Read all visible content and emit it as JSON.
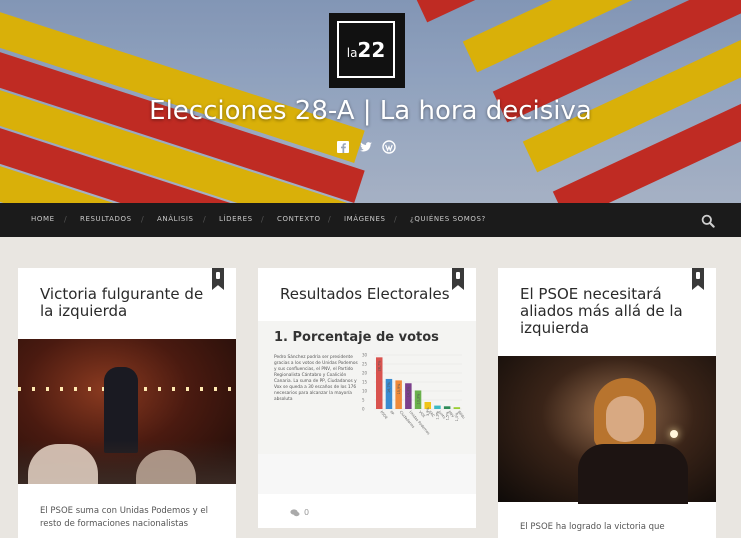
{
  "site": {
    "logo_prefix": "la",
    "logo_number": "22",
    "title": "Elecciones 28-A | La hora decisiva",
    "social_icons": [
      "facebook-icon",
      "twitter-icon",
      "wordpress-icon"
    ]
  },
  "nav": {
    "items": [
      "HOME",
      "RESULTADOS",
      "ANÁLISIS",
      "LÍDERES",
      "CONTEXTO",
      "IMÁGENES",
      "¿QUIÉNES SOMOS?"
    ],
    "separator": "/",
    "search_icon": "search-icon"
  },
  "colors": {
    "nav_bg": "#1b1b1b",
    "page_bg": "#e9e6e1",
    "flag_red": "#d42b1e",
    "flag_yellow": "#f2c200"
  },
  "posts": [
    {
      "title": "Victoria fulgurante de la izquierda",
      "excerpt": "El PSOE suma con Unidas Podemos y el resto de formaciones nacionalistas"
    },
    {
      "title": "Resultados Electorales",
      "chart_heading": "1. Porcentaje de votos",
      "chart_text": "Pedro Sánchez podría ser presidente gracias a los votos de Unidas Podemos y sus confluencias, el PNV, el Partido Regionalista Cántabro y Coalición Canaria. La suma de PP, Ciudadanos y Vox se queda a 30 escaños de los 176 necesarios para alcanzar la mayoría absoluta",
      "comments": "0"
    },
    {
      "title": "El PSOE necesitará aliados más allá de la izquierda",
      "excerpt": "El PSOE ha logrado la victoria que"
    }
  ],
  "chart_data": {
    "type": "bar",
    "title": "1. Porcentaje de votos",
    "categories": [
      "PSOE",
      "PP",
      "Ciudadanos",
      "Unidas Podemos",
      "VOX",
      "ERC",
      "Junts",
      "PNV",
      "Bildu"
    ],
    "values": [
      28.7,
      16.7,
      15.9,
      14.3,
      10.3,
      3.9,
      1.9,
      1.5,
      1.0
    ],
    "colors": [
      "#d9534f",
      "#3a8bd0",
      "#f08a3a",
      "#7b3f8c",
      "#6ab04c",
      "#f0c419",
      "#3bb8c4",
      "#2e8b57",
      "#9acd32"
    ],
    "y_ticks": [
      "30",
      "25",
      "20",
      "15",
      "10",
      "5",
      "0"
    ],
    "ylim": [
      0,
      30
    ]
  }
}
